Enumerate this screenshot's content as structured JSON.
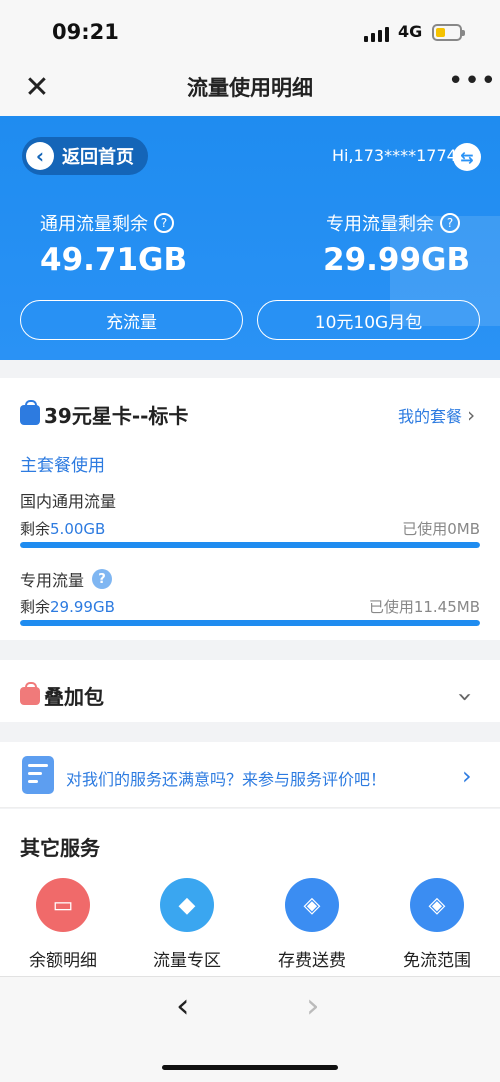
{
  "status": {
    "time": "09:21",
    "network": "4G"
  },
  "nav": {
    "title": "流量使用明细",
    "more": "•••"
  },
  "hero": {
    "back_label": "返回首页",
    "greeting": "Hi,173****1774",
    "general": {
      "label": "通用流量剩余",
      "value": "49.71GB"
    },
    "dedicated": {
      "label": "专用流量剩余",
      "value": "29.99GB"
    },
    "recharge_button": "充流量",
    "monthly_pack_button": "10元10G月包"
  },
  "plan": {
    "name": "39元星卡--标卡",
    "my_plan_link": "我的套餐",
    "main_section": "主套餐使用",
    "domestic": {
      "label": "国内通用流量",
      "remain_prefix": "剩余",
      "remain_value": "5.00GB",
      "used": "已使用0MB",
      "fill_percent": 100
    },
    "dedicated": {
      "label": "专用流量",
      "remain_prefix": "剩余",
      "remain_value": "29.99GB",
      "used": "已使用11.45MB",
      "fill_percent": 100
    }
  },
  "addon": {
    "title": "叠加包"
  },
  "survey": {
    "text": "对我们的服务还满意吗？来参与服务评价吧！"
  },
  "services": {
    "title": "其它服务",
    "items": [
      {
        "label": "余额明细",
        "icon": "wallet-icon",
        "color": "#f06a6a"
      },
      {
        "label": "流量专区",
        "icon": "cube-icon",
        "color": "#3aa6f0"
      },
      {
        "label": "存费送费",
        "icon": "tag-icon",
        "color": "#3b8df2"
      },
      {
        "label": "免流范围",
        "icon": "tag-icon",
        "color": "#3b8df2"
      }
    ]
  }
}
